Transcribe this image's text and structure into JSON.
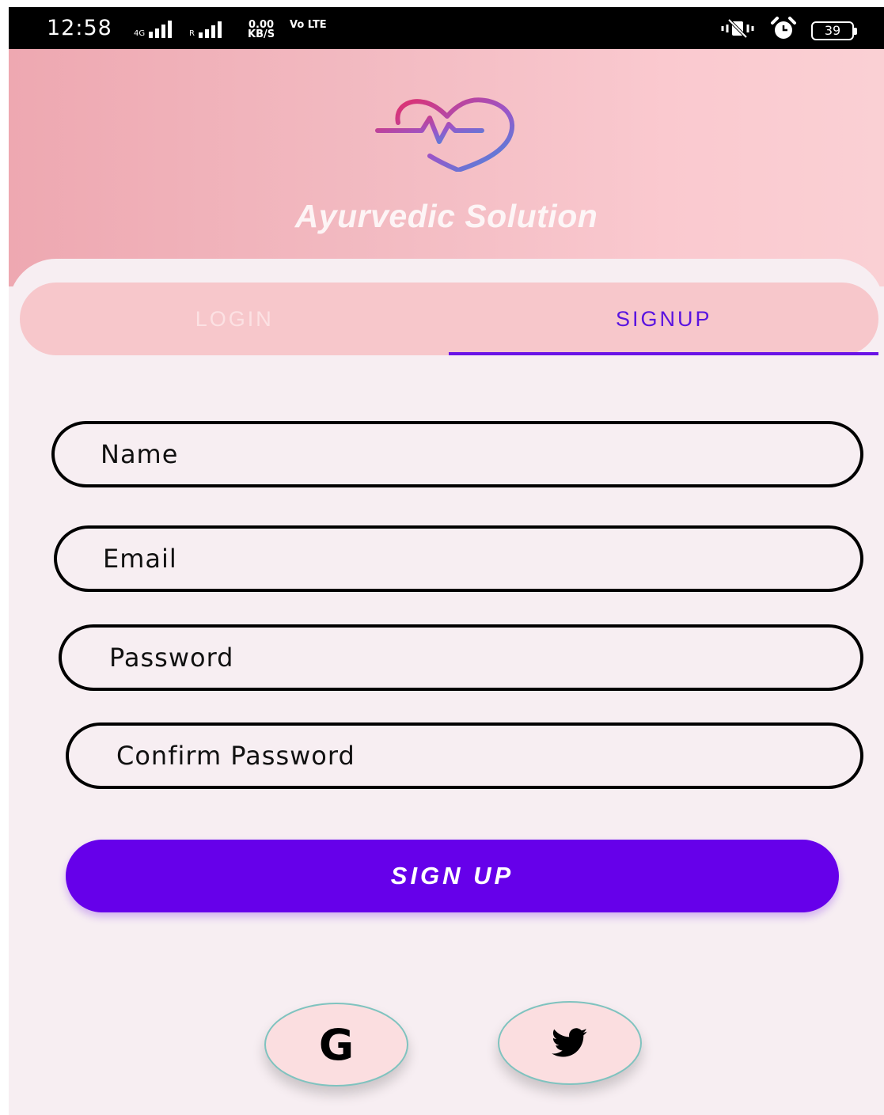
{
  "status_bar": {
    "time": "12:58",
    "network_type": "4G",
    "roaming": "R",
    "speed_value": "0.00",
    "speed_unit": "KB/S",
    "volte": "Vo LTE",
    "battery": "39",
    "icons": [
      "vibrate-icon",
      "alarm-icon",
      "battery-icon"
    ]
  },
  "header": {
    "logo": "heartbeat-heart-icon",
    "title": "Ayurvedic Solution"
  },
  "tabs": [
    {
      "label": "LOGIN",
      "selected": false
    },
    {
      "label": "SIGNUP",
      "selected": true
    }
  ],
  "form": {
    "name_placeholder": "Name",
    "email_placeholder": "Email",
    "password_placeholder": "Password",
    "confirm_placeholder": "Confirm Password",
    "submit_label": "SIGN UP"
  },
  "social": {
    "google_glyph": "G",
    "google_icon": "google-icon",
    "twitter_icon": "twitter-icon"
  },
  "colors": {
    "accent": "#6600ea",
    "tab_selected": "#5a14e0",
    "header_start": "#eea8b1",
    "header_end": "#fad0d4",
    "background": "#f7eef2",
    "social_border": "#7fc3bf"
  }
}
